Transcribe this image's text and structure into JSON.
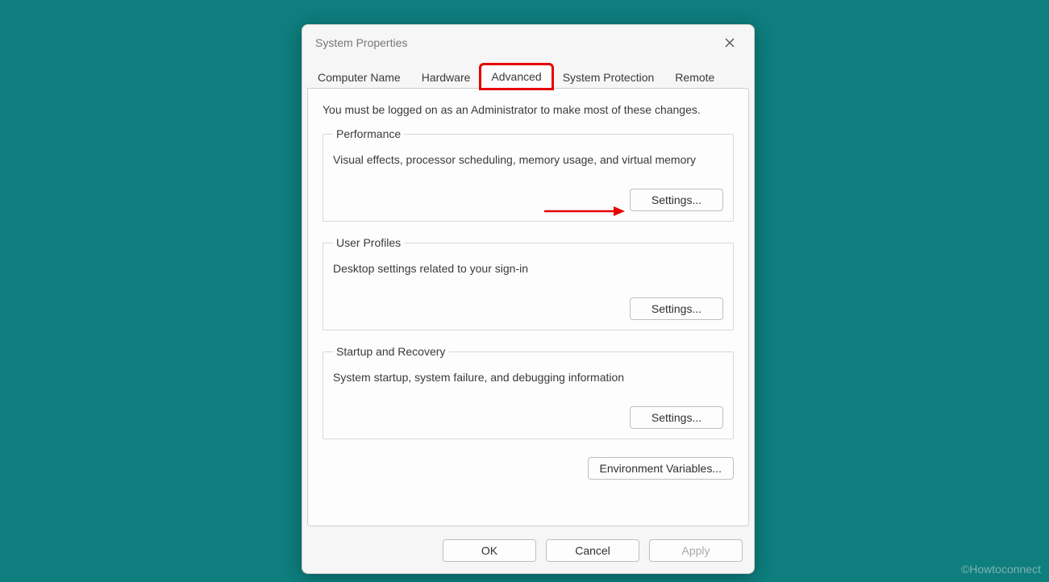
{
  "window": {
    "title": "System Properties"
  },
  "tabs": {
    "computer_name": "Computer Name",
    "hardware": "Hardware",
    "advanced": "Advanced",
    "system_protection": "System Protection",
    "remote": "Remote"
  },
  "intro": "You must be logged on as an Administrator to make most of these changes.",
  "groups": {
    "performance": {
      "legend": "Performance",
      "desc": "Visual effects, processor scheduling, memory usage, and virtual memory",
      "button": "Settings..."
    },
    "user_profiles": {
      "legend": "User Profiles",
      "desc": "Desktop settings related to your sign-in",
      "button": "Settings..."
    },
    "startup": {
      "legend": "Startup and Recovery",
      "desc": "System startup, system failure, and debugging information",
      "button": "Settings..."
    }
  },
  "env_button": "Environment Variables...",
  "buttons": {
    "ok": "OK",
    "cancel": "Cancel",
    "apply": "Apply"
  },
  "watermark": "©Howtoconnect"
}
